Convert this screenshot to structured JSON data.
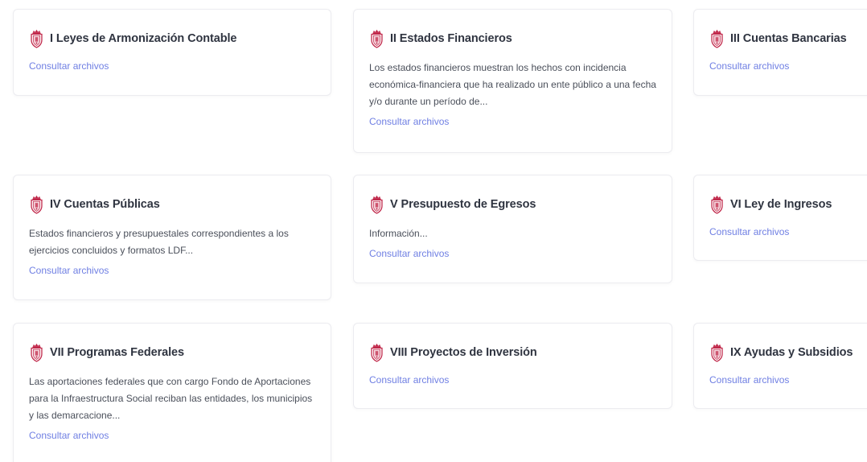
{
  "colors": {
    "accent_link": "#6f7fe3",
    "crest": "#c0284a",
    "title": "#2f3440",
    "text": "#4a4f5a"
  },
  "icon": "crest-icon",
  "cards": [
    {
      "title": "I Leyes de Armonización Contable",
      "description": "",
      "link": "Consultar archivos"
    },
    {
      "title": "II Estados Financieros",
      "description": "Los estados financieros muestran los hechos con incidencia económica-financiera que ha realizado un ente público a una fecha y/o durante un período de...",
      "link": "Consultar archivos"
    },
    {
      "title": "III Cuentas Bancarias",
      "description": "",
      "link": "Consultar archivos"
    },
    {
      "title": "IV Cuentas Públicas",
      "description": "Estados financieros y presupuestales correspondientes a los ejercicios concluidos y formatos LDF...",
      "link": "Consultar archivos"
    },
    {
      "title": "V Presupuesto de Egresos",
      "description": "Información...",
      "link": "Consultar archivos"
    },
    {
      "title": "VI Ley de Ingresos",
      "description": "",
      "link": "Consultar archivos"
    },
    {
      "title": "VII Programas Federales",
      "description": "Las aportaciones federales que con cargo Fondo de Aportaciones para la Infraestructura Social reciban las entidades, los municipios y las demarcacione...",
      "link": "Consultar archivos"
    },
    {
      "title": "VIII Proyectos de Inversión",
      "description": "",
      "link": "Consultar archivos"
    },
    {
      "title": "IX Ayudas y Subsidios",
      "description": "",
      "link": "Consultar archivos"
    }
  ]
}
